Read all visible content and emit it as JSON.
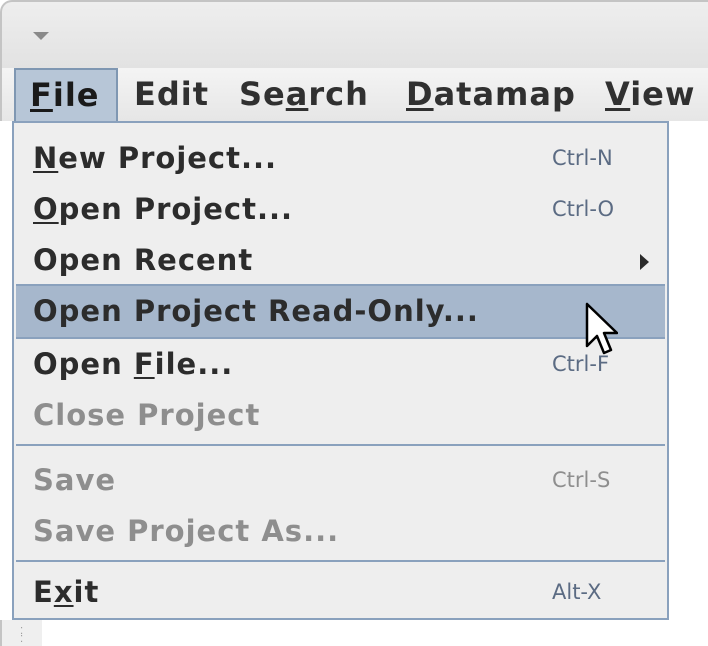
{
  "menubar": {
    "items": [
      {
        "pre": "",
        "key": "F",
        "post": "ile"
      },
      {
        "pre": "Edit",
        "key": "",
        "post": ""
      },
      {
        "pre": "Se",
        "key": "a",
        "post": "rch"
      },
      {
        "pre": "",
        "key": "D",
        "post": "atamap"
      },
      {
        "pre": "",
        "key": "V",
        "post": "iew"
      }
    ]
  },
  "file_menu": {
    "new_project": {
      "pre": "",
      "key": "N",
      "post": "ew Project...",
      "shortcut": "Ctrl-N"
    },
    "open_project": {
      "pre": "",
      "key": "O",
      "post": "pen Project...",
      "shortcut": "Ctrl-O"
    },
    "open_recent": {
      "label": "Open Recent"
    },
    "open_read_only": {
      "label": "Open Project Read-Only..."
    },
    "open_file": {
      "pre": "Open ",
      "key": "F",
      "post": "ile...",
      "shortcut": "Ctrl-F"
    },
    "close_project": {
      "label": "Close Project"
    },
    "save": {
      "label": "Save",
      "shortcut": "Ctrl-S"
    },
    "save_project_as": {
      "label": "Save Project As..."
    },
    "exit": {
      "pre": "E",
      "key": "x",
      "post": "it",
      "shortcut": "Alt-X"
    }
  },
  "colors": {
    "highlight": "#a6b7cc",
    "menu_border": "#8aa1bd",
    "menu_bg": "#eeeeee",
    "disabled_text": "#8e8e8e",
    "shortcut_text": "#5b6b83"
  },
  "icons": {
    "window_menu": "triangle-down-icon",
    "submenu": "triangle-right-icon",
    "cursor": "arrow-cursor-icon",
    "resize_grip": "resize-grip-icon"
  }
}
